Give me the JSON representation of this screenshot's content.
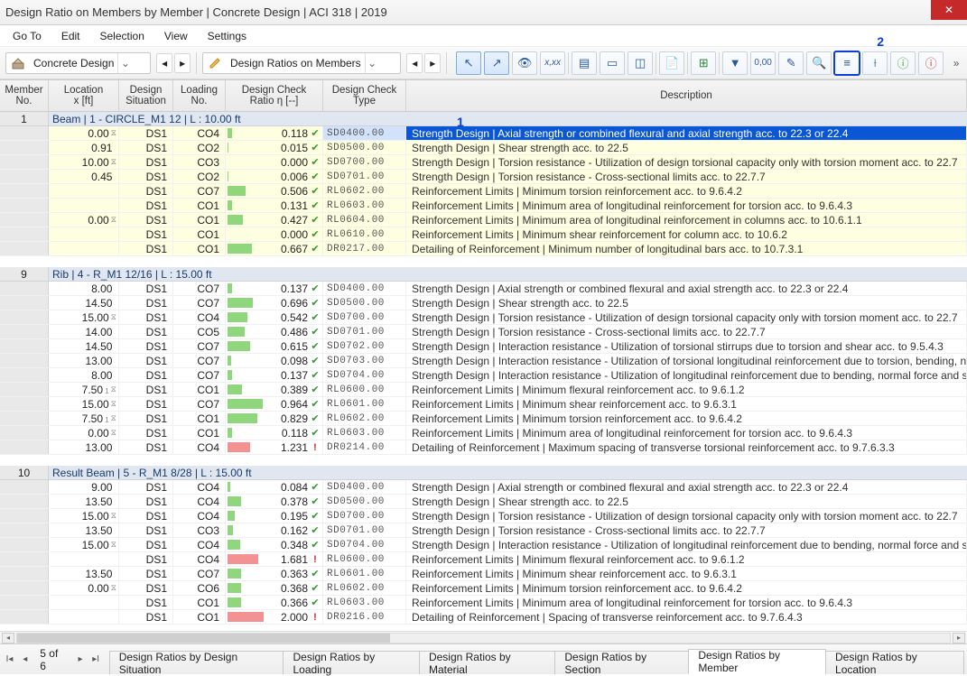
{
  "title": "Design Ratio on Members by Member | Concrete Design | ACI 318 | 2019",
  "menu": {
    "goto": "Go To",
    "edit": "Edit",
    "selection": "Selection",
    "view": "View",
    "settings": "Settings"
  },
  "toolbar": {
    "combo1_label": "Concrete Design",
    "combo2_label": "Design Ratios on Members"
  },
  "callouts": {
    "c1": "1",
    "c2": "2"
  },
  "columns": {
    "member": "Member\nNo.",
    "location": "Location\nx [ft]",
    "situation": "Design\nSituation",
    "loading": "Loading\nNo.",
    "ratio": "Design Check\nRatio η [--]",
    "dtype": "Design Check\nType",
    "desc": "Description"
  },
  "groups": [
    {
      "no": "1",
      "title": "Beam | 1 - CIRCLE_M1 12 | L : 10.00 ft",
      "yellow": true,
      "rows": [
        {
          "loc": "0.00",
          "x": true,
          "ds": "DS1",
          "lno": "CO4",
          "ratio": 0.118,
          "ok": true,
          "code": "SD0400.00",
          "desc": "Strength Design | Axial strength or combined flexural and axial strength acc. to 22.3 or 22.4",
          "sel": true
        },
        {
          "loc": "0.91",
          "x": false,
          "ds": "DS1",
          "lno": "CO2",
          "ratio": 0.015,
          "ok": true,
          "code": "SD0500.00",
          "desc": "Strength Design | Shear strength acc. to 22.5"
        },
        {
          "loc": "10.00",
          "x": true,
          "ds": "DS1",
          "lno": "CO3",
          "ratio": 0.0,
          "ok": true,
          "code": "SD0700.00",
          "desc": "Strength Design | Torsion resistance - Utilization of design torsional capacity only with torsion moment acc. to 22.7"
        },
        {
          "loc": "0.45",
          "x": false,
          "ds": "DS1",
          "lno": "CO2",
          "ratio": 0.006,
          "ok": true,
          "code": "SD0701.00",
          "desc": "Strength Design | Torsion resistance - Cross-sectional limits acc. to 22.7.7"
        },
        {
          "loc": "",
          "x": false,
          "ds": "DS1",
          "lno": "CO7",
          "ratio": 0.506,
          "ok": true,
          "code": "RL0602.00",
          "desc": "Reinforcement Limits | Minimum torsion reinforcement acc. to 9.6.4.2"
        },
        {
          "loc": "",
          "x": false,
          "ds": "DS1",
          "lno": "CO1",
          "ratio": 0.131,
          "ok": true,
          "code": "RL0603.00",
          "desc": "Reinforcement Limits | Minimum area of longitudinal reinforcement for torsion acc. to 9.6.4.3"
        },
        {
          "loc": "0.00",
          "x": true,
          "ds": "DS1",
          "lno": "CO1",
          "ratio": 0.427,
          "ok": true,
          "code": "RL0604.00",
          "desc": "Reinforcement Limits | Minimum area of longitudinal reinforcement in columns acc. to 10.6.1.1"
        },
        {
          "loc": "",
          "x": false,
          "ds": "DS1",
          "lno": "CO1",
          "ratio": 0.0,
          "ok": true,
          "code": "RL0610.00",
          "desc": "Reinforcement Limits | Minimum shear reinforcement for column acc. to 10.6.2"
        },
        {
          "loc": "",
          "x": false,
          "ds": "DS1",
          "lno": "CO1",
          "ratio": 0.667,
          "ok": true,
          "code": "DR0217.00",
          "desc": "Detailing of Reinforcement | Minimum number of longitudinal bars acc. to 10.7.3.1"
        }
      ]
    },
    {
      "no": "9",
      "title": "Rib | 4 - R_M1 12/16 | L : 15.00 ft",
      "yellow": false,
      "rows": [
        {
          "loc": "8.00",
          "x": false,
          "ds": "DS1",
          "lno": "CO7",
          "ratio": 0.137,
          "ok": true,
          "code": "SD0400.00",
          "desc": "Strength Design | Axial strength or combined flexural and axial strength acc. to 22.3 or 22.4"
        },
        {
          "loc": "14.50",
          "x": false,
          "ds": "DS1",
          "lno": "CO7",
          "ratio": 0.696,
          "ok": true,
          "code": "SD0500.00",
          "desc": "Strength Design | Shear strength acc. to 22.5"
        },
        {
          "loc": "15.00",
          "x": true,
          "ds": "DS1",
          "lno": "CO4",
          "ratio": 0.542,
          "ok": true,
          "code": "SD0700.00",
          "desc": "Strength Design | Torsion resistance - Utilization of design torsional capacity only with torsion moment acc. to 22.7"
        },
        {
          "loc": "14.00",
          "x": false,
          "ds": "DS1",
          "lno": "CO5",
          "ratio": 0.486,
          "ok": true,
          "code": "SD0701.00",
          "desc": "Strength Design | Torsion resistance - Cross-sectional limits acc. to 22.7.7"
        },
        {
          "loc": "14.50",
          "x": false,
          "ds": "DS1",
          "lno": "CO7",
          "ratio": 0.615,
          "ok": true,
          "code": "SD0702.00",
          "desc": "Strength Design | Interaction resistance - Utilization of torsional stirrups due to torsion and shear acc. to 9.5.4.3"
        },
        {
          "loc": "13.00",
          "x": false,
          "ds": "DS1",
          "lno": "CO7",
          "ratio": 0.098,
          "ok": true,
          "code": "SD0703.00",
          "desc": "Strength Design | Interaction resistance - Utilization of torsional longitudinal reinforcement due to torsion, bending, no"
        },
        {
          "loc": "8.00",
          "x": false,
          "ds": "DS1",
          "lno": "CO7",
          "ratio": 0.137,
          "ok": true,
          "code": "SD0704.00",
          "desc": "Strength Design | Interaction resistance - Utilization of longitudinal reinforcement due to bending, normal force and sh"
        },
        {
          "loc": "7.50",
          "x": true,
          "sub": "1",
          "ds": "DS1",
          "lno": "CO1",
          "ratio": 0.389,
          "ok": true,
          "code": "RL0600.00",
          "desc": "Reinforcement Limits | Minimum flexural reinforcement acc. to 9.6.1.2"
        },
        {
          "loc": "15.00",
          "x": true,
          "ds": "DS1",
          "lno": "CO7",
          "ratio": 0.964,
          "ok": true,
          "code": "RL0601.00",
          "desc": "Reinforcement Limits | Minimum shear reinforcement acc. to 9.6.3.1"
        },
        {
          "loc": "7.50",
          "x": true,
          "sub": "1",
          "ds": "DS1",
          "lno": "CO1",
          "ratio": 0.829,
          "ok": true,
          "code": "RL0602.00",
          "desc": "Reinforcement Limits | Minimum torsion reinforcement acc. to 9.6.4.2"
        },
        {
          "loc": "0.00",
          "x": true,
          "ds": "DS1",
          "lno": "CO1",
          "ratio": 0.118,
          "ok": true,
          "code": "RL0603.00",
          "desc": "Reinforcement Limits | Minimum area of longitudinal reinforcement for torsion acc. to 9.6.4.3"
        },
        {
          "loc": "13.00",
          "x": false,
          "ds": "DS1",
          "lno": "CO4",
          "ratio": 1.231,
          "ok": false,
          "code": "DR0214.00",
          "desc": "Detailing of Reinforcement | Maximum spacing of transverse torsional reinforcement acc. to 9.7.6.3.3"
        }
      ]
    },
    {
      "no": "10",
      "title": "Result Beam | 5 - R_M1 8/28 | L : 15.00 ft",
      "yellow": false,
      "rows": [
        {
          "loc": "9.00",
          "x": false,
          "ds": "DS1",
          "lno": "CO4",
          "ratio": 0.084,
          "ok": true,
          "code": "SD0400.00",
          "desc": "Strength Design | Axial strength or combined flexural and axial strength acc. to 22.3 or 22.4"
        },
        {
          "loc": "13.50",
          "x": false,
          "ds": "DS1",
          "lno": "CO4",
          "ratio": 0.378,
          "ok": true,
          "code": "SD0500.00",
          "desc": "Strength Design | Shear strength acc. to 22.5"
        },
        {
          "loc": "15.00",
          "x": true,
          "ds": "DS1",
          "lno": "CO4",
          "ratio": 0.195,
          "ok": true,
          "code": "SD0700.00",
          "desc": "Strength Design | Torsion resistance - Utilization of design torsional capacity only with torsion moment acc. to 22.7"
        },
        {
          "loc": "13.50",
          "x": false,
          "ds": "DS1",
          "lno": "CO3",
          "ratio": 0.162,
          "ok": true,
          "code": "SD0701.00",
          "desc": "Strength Design | Torsion resistance - Cross-sectional limits acc. to 22.7.7"
        },
        {
          "loc": "15.00",
          "x": true,
          "ds": "DS1",
          "lno": "CO4",
          "ratio": 0.348,
          "ok": true,
          "code": "SD0704.00",
          "desc": "Strength Design | Interaction resistance - Utilization of longitudinal reinforcement due to bending, normal force and sh"
        },
        {
          "loc": "",
          "x": false,
          "ds": "DS1",
          "lno": "CO4",
          "ratio": 1.681,
          "ok": false,
          "code": "RL0600.00",
          "desc": "Reinforcement Limits | Minimum flexural reinforcement acc. to 9.6.1.2"
        },
        {
          "loc": "13.50",
          "x": false,
          "ds": "DS1",
          "lno": "CO7",
          "ratio": 0.363,
          "ok": true,
          "code": "RL0601.00",
          "desc": "Reinforcement Limits | Minimum shear reinforcement acc. to 9.6.3.1"
        },
        {
          "loc": "0.00",
          "x": true,
          "ds": "DS1",
          "lno": "CO6",
          "ratio": 0.368,
          "ok": true,
          "code": "RL0602.00",
          "desc": "Reinforcement Limits | Minimum torsion reinforcement acc. to 9.6.4.2"
        },
        {
          "loc": "",
          "x": false,
          "ds": "DS1",
          "lno": "CO1",
          "ratio": 0.366,
          "ok": true,
          "code": "RL0603.00",
          "desc": "Reinforcement Limits | Minimum area of longitudinal reinforcement for torsion acc. to 9.6.4.3"
        },
        {
          "loc": "",
          "x": false,
          "ds": "DS1",
          "lno": "CO1",
          "ratio": 2.0,
          "ok": false,
          "code": "DR0216.00",
          "desc": "Detailing of Reinforcement | Spacing of transverse reinforcement acc. to 9.7.6.4.3"
        }
      ]
    }
  ],
  "pager": {
    "text": "5 of 6"
  },
  "tabs": {
    "t1": "Design Ratios by Design Situation",
    "t2": "Design Ratios by Loading",
    "t3": "Design Ratios by Material",
    "t4": "Design Ratios by Section",
    "t5": "Design Ratios by Member",
    "t6": "Design Ratios by Location"
  }
}
